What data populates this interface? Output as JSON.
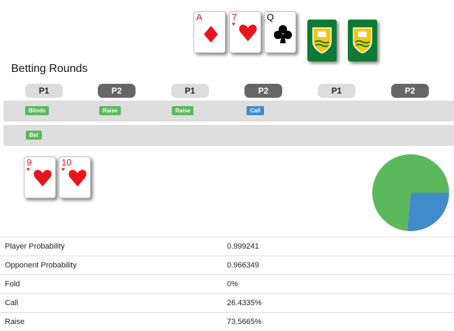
{
  "board_cards": [
    {
      "rank": "A",
      "suit": "diamond",
      "color": "#e8151b"
    },
    {
      "rank": "7",
      "suit": "heart",
      "color": "#e8151b"
    },
    {
      "rank": "Q",
      "suit": "club",
      "color": "#000000"
    }
  ],
  "hidden_cards": 2,
  "betting": {
    "title": "Betting Rounds",
    "players": [
      "P1",
      "P2",
      "P1",
      "P2",
      "P1",
      "P2"
    ],
    "round1": [
      "Blinds",
      "Raise",
      "Raise",
      "Call"
    ],
    "round2": [
      "Bet"
    ]
  },
  "hand_cards": [
    {
      "rank": "9",
      "suit": "heart",
      "color": "#e8151b"
    },
    {
      "rank": "10",
      "suit": "heart",
      "color": "#e8151b"
    }
  ],
  "chart_data": {
    "type": "pie",
    "categories": [
      "Fold",
      "Call",
      "Raise"
    ],
    "values": [
      0,
      26.4335,
      73.5665
    ],
    "colors": [
      "#dddddd",
      "#428bca",
      "#5cb85c"
    ]
  },
  "stats": [
    {
      "label": "Player Probability",
      "value": "0.999241"
    },
    {
      "label": "Opponent Probability",
      "value": "0.966349"
    },
    {
      "label": "Fold",
      "value": "0%"
    },
    {
      "label": "Call",
      "value": "26.4335%"
    },
    {
      "label": "Raise",
      "value": "73.5665%"
    }
  ],
  "colors": {
    "red_suit": "#e8151b",
    "card_back": "#0e7a34",
    "tag_green": "#5cb85c",
    "tag_blue": "#428bca",
    "band": "#dedede"
  }
}
